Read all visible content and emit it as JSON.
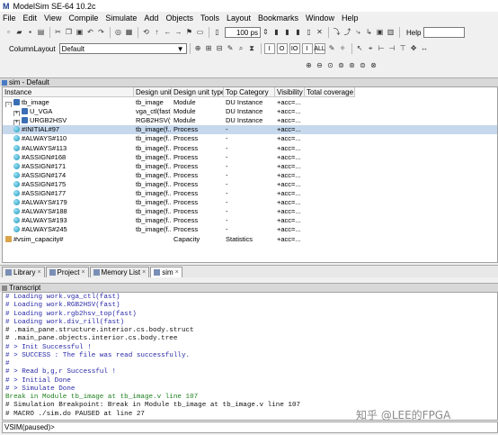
{
  "window": {
    "title": "ModelSim SE-64 10.2c",
    "logo": "M"
  },
  "menu": [
    "File",
    "Edit",
    "View",
    "Compile",
    "Simulate",
    "Add",
    "Objects",
    "Tools",
    "Layout",
    "Bookmarks",
    "Window",
    "Help"
  ],
  "toolbar": {
    "run_length": "100 ps",
    "help_label": "Help",
    "column_layout_label": "ColumnLayout",
    "column_layout_value": "Default"
  },
  "structure_pane": {
    "title": "sim - Default",
    "columns": [
      "Instance",
      "Design unit",
      "Design unit type",
      "Top Category",
      "Visibility",
      "Total coverage"
    ],
    "rows": [
      {
        "instance": "tb_image",
        "unit": "tb_image",
        "type": "Module",
        "cat": "DU Instance",
        "vis": "+acc=...",
        "expand": "-",
        "icon": "mod",
        "indent": 0
      },
      {
        "instance": "U_VGA",
        "unit": "vga_ctl(fast)",
        "type": "Module",
        "cat": "DU Instance",
        "vis": "+acc=...",
        "expand": "+",
        "icon": "mod",
        "indent": 1
      },
      {
        "instance": "URGB2HSV",
        "unit": "RGB2HSV(fast)",
        "type": "Module",
        "cat": "DU Instance",
        "vis": "+acc=...",
        "expand": "+",
        "icon": "mod",
        "indent": 1
      },
      {
        "instance": "#INITIAL#97",
        "unit": "tb_image(f...",
        "type": "Process",
        "cat": "-",
        "vis": "+acc=...",
        "icon": "proc",
        "indent": 1,
        "selected": true
      },
      {
        "instance": "#ALWAYS#110",
        "unit": "tb_image(f...",
        "type": "Process",
        "cat": "-",
        "vis": "+acc=...",
        "icon": "proc",
        "indent": 1
      },
      {
        "instance": "#ALWAYS#113",
        "unit": "tb_image(f...",
        "type": "Process",
        "cat": "-",
        "vis": "+acc=...",
        "icon": "proc",
        "indent": 1
      },
      {
        "instance": "#ASSIGN#168",
        "unit": "tb_image(f...",
        "type": "Process",
        "cat": "-",
        "vis": "+acc=...",
        "icon": "proc",
        "indent": 1
      },
      {
        "instance": "#ASSIGN#171",
        "unit": "tb_image(f...",
        "type": "Process",
        "cat": "-",
        "vis": "+acc=...",
        "icon": "proc",
        "indent": 1
      },
      {
        "instance": "#ASSIGN#174",
        "unit": "tb_image(f...",
        "type": "Process",
        "cat": "-",
        "vis": "+acc=...",
        "icon": "proc",
        "indent": 1
      },
      {
        "instance": "#ASSIGN#175",
        "unit": "tb_image(f...",
        "type": "Process",
        "cat": "-",
        "vis": "+acc=...",
        "icon": "proc",
        "indent": 1
      },
      {
        "instance": "#ASSIGN#177",
        "unit": "tb_image(f...",
        "type": "Process",
        "cat": "-",
        "vis": "+acc=...",
        "icon": "proc",
        "indent": 1
      },
      {
        "instance": "#ALWAYS#179",
        "unit": "tb_image(f...",
        "type": "Process",
        "cat": "-",
        "vis": "+acc=...",
        "icon": "proc",
        "indent": 1
      },
      {
        "instance": "#ALWAYS#188",
        "unit": "tb_image(f...",
        "type": "Process",
        "cat": "-",
        "vis": "+acc=...",
        "icon": "proc",
        "indent": 1
      },
      {
        "instance": "#ALWAYS#193",
        "unit": "tb_image(f...",
        "type": "Process",
        "cat": "-",
        "vis": "+acc=...",
        "icon": "proc",
        "indent": 1
      },
      {
        "instance": "#ALWAYS#245",
        "unit": "tb_image(f...",
        "type": "Process",
        "cat": "-",
        "vis": "+acc=...",
        "icon": "proc",
        "indent": 1
      },
      {
        "instance": "#vsim_capacity#",
        "unit": "",
        "type": "Capacity",
        "cat": "Statistics",
        "vis": "+acc=...",
        "icon": "cap",
        "indent": 0
      }
    ]
  },
  "tabs": [
    "Library",
    "Project",
    "Memory List",
    "sim"
  ],
  "active_tab": "sim",
  "transcript": {
    "title": "Transcript",
    "lines": [
      {
        "t": "# Loading work.vga_ctl(fast)",
        "c": "blue"
      },
      {
        "t": "# Loading work.RGB2HSV(fast)",
        "c": "blue"
      },
      {
        "t": "# Loading work.rgb2hsv_top(fast)",
        "c": "blue"
      },
      {
        "t": "# Loading work.div_rill(fast)",
        "c": "blue"
      },
      {
        "t": "# .main_pane.structure.interior.cs.body.struct",
        "c": "black"
      },
      {
        "t": "# .main_pane.objects.interior.cs.body.tree",
        "c": "black"
      },
      {
        "t": "# > Init Successful !",
        "c": "blue"
      },
      {
        "t": "# > SUCCESS : The file was read successfully.",
        "c": "blue"
      },
      {
        "t": "#",
        "c": "blue"
      },
      {
        "t": "# > Read b,g,r Successful !",
        "c": "blue"
      },
      {
        "t": "# > Initial Done",
        "c": "blue"
      },
      {
        "t": "# > Simulate Done",
        "c": "blue"
      },
      {
        "t": "Break in Module tb_image at tb_image.v line 107",
        "c": "green"
      },
      {
        "t": "# Simulation Breakpoint: Break in Module tb_image at tb_image.v line 107",
        "c": "black"
      },
      {
        "t": "# MACRO ./sim.do PAUSED at line 27",
        "c": "black"
      }
    ]
  },
  "prompt": "VSIM(paused)>",
  "watermark": "知乎 @LEE的FPGA"
}
